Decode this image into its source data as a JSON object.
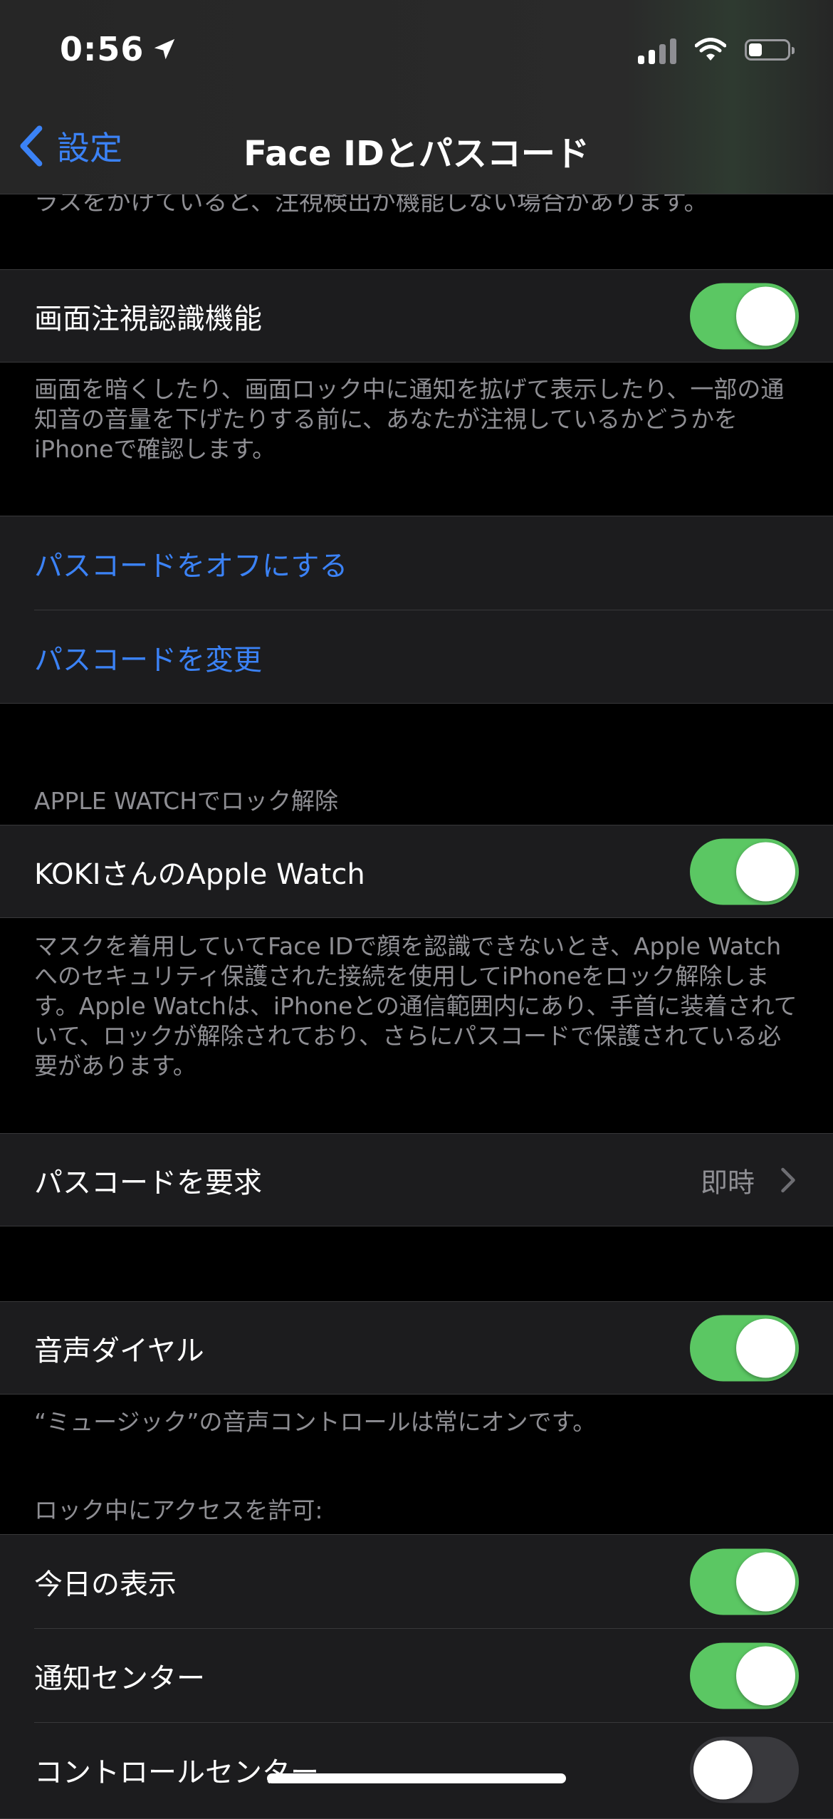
{
  "status_bar": {
    "time": "0:56",
    "battery_level": 0.35
  },
  "nav": {
    "back_label": "設定",
    "title": "Face IDとパスコード"
  },
  "cut_footer": "ラスをかけていると、注視検出が機能しない場合があります。",
  "attention": {
    "label": "画面注視認識機能",
    "on": true,
    "footer": "画面を暗くしたり、画面ロック中に通知を拡げて表示したり、一部の通知音の音量を下げたりする前に、あなたが注視しているかどうかをiPhoneで確認します。"
  },
  "passcode_links": {
    "turn_off": "パスコードをオフにする",
    "change": "パスコードを変更"
  },
  "apple_watch": {
    "header": "APPLE WATCHでロック解除",
    "label": "KOKIさんのApple Watch",
    "on": true,
    "footer": "マスクを着用していてFace IDで顔を認識できないとき、Apple Watchへのセキュリティ保護された接続を使用してiPhoneをロック解除します。Apple Watchは、iPhoneとの通信範囲内にあり、手首に装着されていて、ロックが解除されており、さらにパスコードで保護されている必要があります。"
  },
  "require_passcode": {
    "label": "パスコードを要求",
    "value": "即時"
  },
  "voice_dial": {
    "label": "音声ダイヤル",
    "on": true,
    "footer": "“ミュージック”の音声コントロールは常にオンです。"
  },
  "locked_access": {
    "header": "ロック中にアクセスを許可:",
    "items": [
      {
        "label": "今日の表示",
        "on": true
      },
      {
        "label": "通知センター",
        "on": true
      },
      {
        "label": "コントロールセンター",
        "on": false
      }
    ]
  },
  "colors": {
    "accent": "#3b82f6",
    "toggle_on": "#5bc763",
    "toggle_off": "#39393d",
    "cell_bg": "#1c1c1e",
    "secondary_text": "#8e8e93"
  },
  "icons": [
    "location-arrow-icon",
    "signal-icon",
    "wifi-icon",
    "battery-icon",
    "chevron-left-icon",
    "chevron-right-icon"
  ]
}
